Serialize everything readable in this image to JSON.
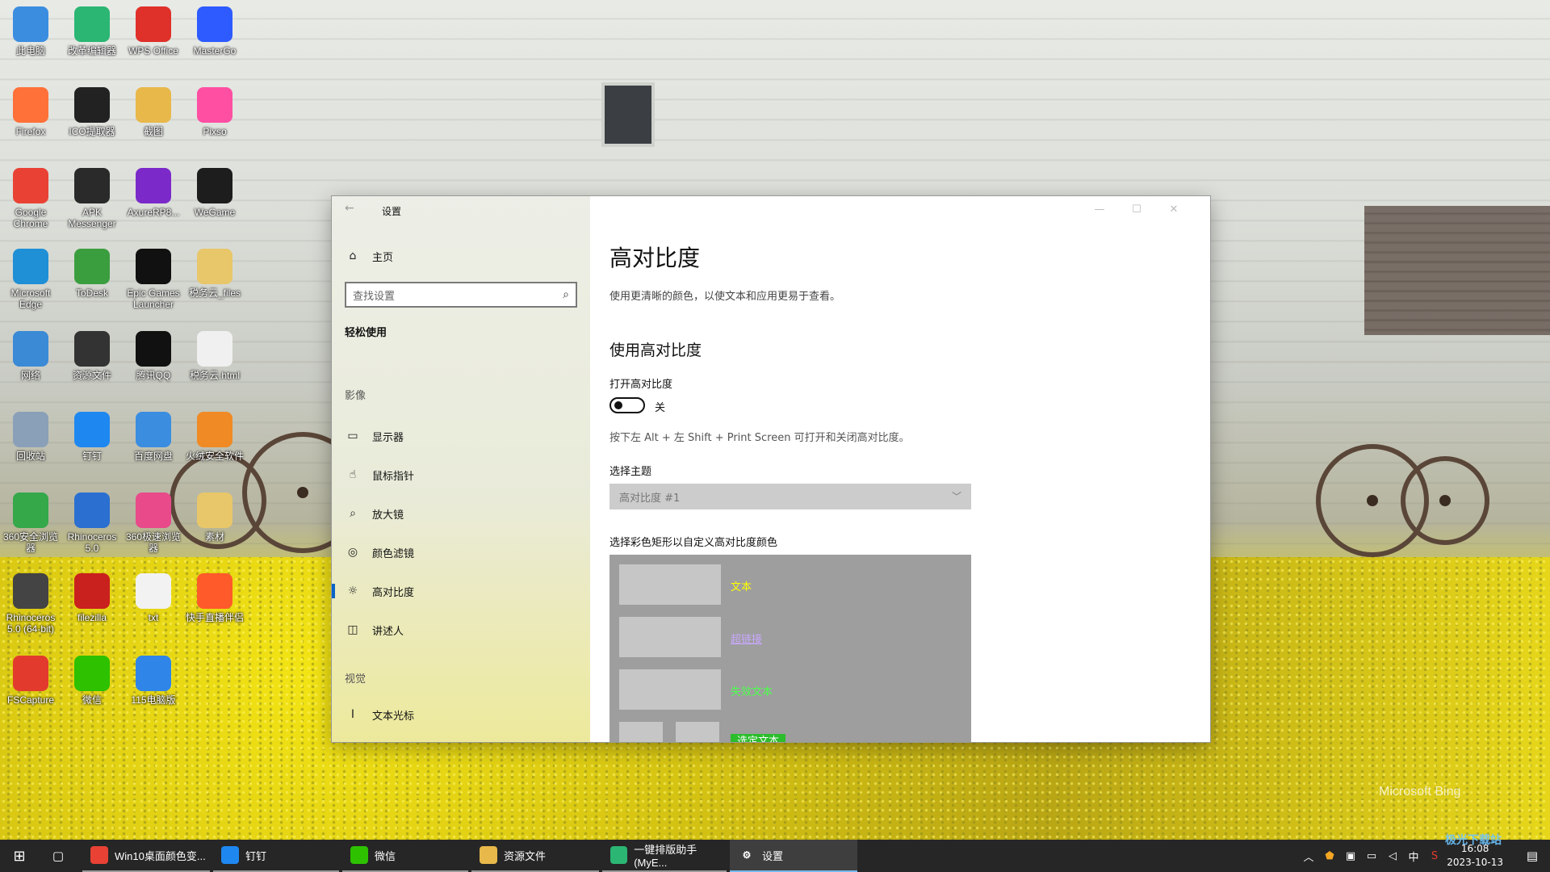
{
  "desktop": {
    "icons": [
      {
        "label": "此电脑",
        "icon": "pc-icon",
        "color": "#3b8de0"
      },
      {
        "label": "改革编辑器",
        "icon": "editor-icon",
        "color": "#2bb673"
      },
      {
        "label": "WPS Office",
        "icon": "wps-icon",
        "color": "#e0302a"
      },
      {
        "label": "MasterGo",
        "icon": "mastergo-icon",
        "color": "#2d5bff"
      },
      {
        "label": "Firefox",
        "icon": "firefox-icon",
        "color": "#ff7139"
      },
      {
        "label": "ICO提取器",
        "icon": "ico-extractor-icon",
        "color": "#222222"
      },
      {
        "label": "截图",
        "icon": "folder-icon",
        "color": "#e8b84a"
      },
      {
        "label": "Pixso",
        "icon": "pixso-icon",
        "color": "#ff4fa3"
      },
      {
        "label": "Google Chrome",
        "icon": "chrome-icon",
        "color": "#e94235"
      },
      {
        "label": "APK Messenger",
        "icon": "apk-messenger-icon",
        "color": "#2a2a2a"
      },
      {
        "label": "AxureRP8...",
        "icon": "axure-icon",
        "color": "#7b2ac9"
      },
      {
        "label": "WeGame",
        "icon": "wegame-icon",
        "color": "#1d1d1d"
      },
      {
        "label": "Microsoft Edge",
        "icon": "edge-icon",
        "color": "#1f8fd6"
      },
      {
        "label": "ToDesk",
        "icon": "todesk-icon",
        "color": "#3a9e3f"
      },
      {
        "label": "Epic Games Launcher",
        "icon": "epic-icon",
        "color": "#111111"
      },
      {
        "label": "税务云_files",
        "icon": "folder-icon",
        "color": "#e8c66a"
      },
      {
        "label": "网络",
        "icon": "network-icon",
        "color": "#3a8ad6"
      },
      {
        "label": "资源文件",
        "icon": "folder-icon",
        "color": "#333333"
      },
      {
        "label": "腾讯QQ",
        "icon": "qq-icon",
        "color": "#111111"
      },
      {
        "label": "税务云.html",
        "icon": "html-icon",
        "color": "#f0f0f0"
      },
      {
        "label": "回收站",
        "icon": "recycle-bin-icon",
        "color": "#8aa0b8"
      },
      {
        "label": "钉钉",
        "icon": "dingtalk-icon",
        "color": "#1e88f0"
      },
      {
        "label": "百度网盘",
        "icon": "baidu-netdisk-icon",
        "color": "#3b8de0"
      },
      {
        "label": "火绒安全软件",
        "icon": "huorong-icon",
        "color": "#f08a24"
      },
      {
        "label": "360安全浏览器",
        "icon": "360-browser-icon",
        "color": "#35a84a"
      },
      {
        "label": "Rhinoceros 5.0",
        "icon": "rhino-icon",
        "color": "#2b6fd0"
      },
      {
        "label": "360极速浏览器",
        "icon": "360-speed-icon",
        "color": "#e84a8a"
      },
      {
        "label": "素材",
        "icon": "folder-icon",
        "color": "#e8c66a"
      },
      {
        "label": "Rhinoceros 5.0 (64-bit)",
        "icon": "rhino64-icon",
        "color": "#444444"
      },
      {
        "label": "filezilla",
        "icon": "filezilla-icon",
        "color": "#c9211e"
      },
      {
        "label": "txt",
        "icon": "txt-file-icon",
        "color": "#f2f2f2"
      },
      {
        "label": "快手直播伴侣",
        "icon": "kuaishou-icon",
        "color": "#ff5a2a"
      },
      {
        "label": "FSCapture",
        "icon": "fscapture-icon",
        "color": "#e23b2e"
      },
      {
        "label": "微信",
        "icon": "wechat-icon",
        "color": "#2dc100"
      },
      {
        "label": "115电脑版",
        "icon": "115-icon",
        "color": "#2f86e8"
      }
    ],
    "bing_label": "Microsoft Bing"
  },
  "window": {
    "title": "设置",
    "back_glyph": "←",
    "controls": {
      "min": "—",
      "max": "☐",
      "close": "✕"
    }
  },
  "nav": {
    "home": "主页",
    "search_placeholder": "查找设置",
    "section": "轻松使用",
    "group_vision": "影像",
    "items": [
      {
        "label": "显示器",
        "icon": "monitor-icon",
        "glyph": "▭"
      },
      {
        "label": "鼠标指针",
        "icon": "mouse-pointer-icon",
        "glyph": "☝"
      },
      {
        "label": "放大镜",
        "icon": "magnifier-icon",
        "glyph": "⌕"
      },
      {
        "label": "颜色滤镜",
        "icon": "color-filter-icon",
        "glyph": "◎"
      },
      {
        "label": "高对比度",
        "icon": "high-contrast-icon",
        "glyph": "☼"
      },
      {
        "label": "讲述人",
        "icon": "narrator-icon",
        "glyph": "◫"
      }
    ],
    "group_visual": "视觉",
    "cursor_item": {
      "label": "文本光标",
      "icon": "text-cursor-icon",
      "glyph": "I"
    }
  },
  "content": {
    "title": "高对比度",
    "description": "使用更清晰的颜色，以使文本和应用更易于查看。",
    "subtitle": "使用高对比度",
    "toggle_label": "打开高对比度",
    "toggle_state": "关",
    "shortcut_hint": "按下左 Alt + 左 Shift + Print Screen 可打开和关闭高对比度。",
    "theme_label": "选择主题",
    "theme_value": "高对比度 #1",
    "palette_label": "选择彩色矩形以自定义高对比度颜色",
    "palette": [
      {
        "label": "文本",
        "color": "#ffff00"
      },
      {
        "label": "超链接",
        "color": "#c8a8ff"
      },
      {
        "label": "失效文本",
        "color": "#4cff4c"
      },
      {
        "label": "选定文本",
        "color": "#ffffff"
      }
    ]
  },
  "taskbar": {
    "items": [
      {
        "label": "Win10桌面颜色变...",
        "icon": "chrome-icon",
        "color": "#e94235"
      },
      {
        "label": "钉钉",
        "icon": "dingtalk-icon",
        "color": "#1e88f0"
      },
      {
        "label": "微信",
        "icon": "wechat-icon",
        "color": "#2dc100"
      },
      {
        "label": "资源文件",
        "icon": "folder-icon",
        "color": "#e8b84a"
      },
      {
        "label": "一键排版助手(MyE...",
        "icon": "editor-icon",
        "color": "#2bb673"
      },
      {
        "label": "设置",
        "icon": "gear-icon",
        "color": "#3e3e3e"
      }
    ],
    "ime": "中",
    "time": "16:08",
    "date": "2023-10-13",
    "watermark": "极光下载站"
  }
}
